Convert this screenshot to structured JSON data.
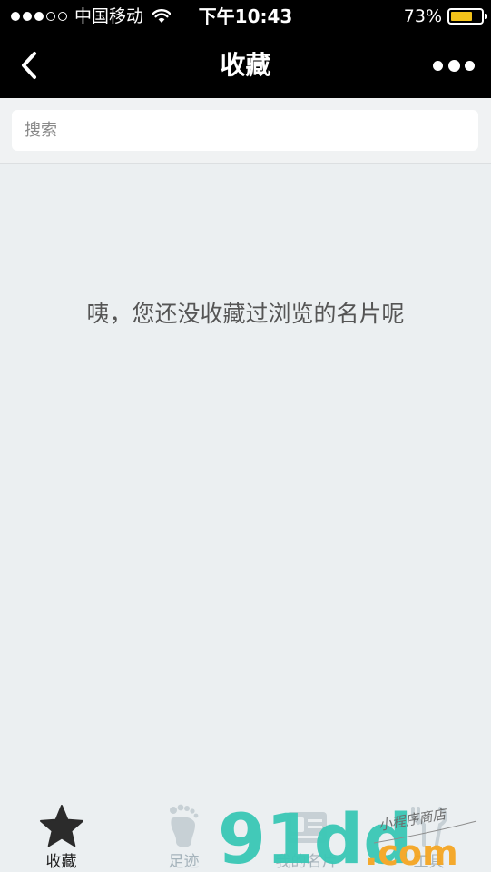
{
  "status_bar": {
    "signal_full": 3,
    "signal_empty": 2,
    "carrier": "中国移动",
    "time": "下午10:43",
    "battery_percent": "73%",
    "battery_level": 0.73,
    "battery_color": "#f3c21a"
  },
  "nav": {
    "title": "收藏",
    "back_icon": "chevron-left-icon",
    "more_icon": "more-dots-icon"
  },
  "search": {
    "placeholder": "搜索",
    "value": ""
  },
  "empty_state": {
    "message": "咦，您还没收藏过浏览的名片呢"
  },
  "tabs": [
    {
      "label": "收藏",
      "icon": "star-icon",
      "active": true
    },
    {
      "label": "足迹",
      "icon": "footprint-icon",
      "active": false
    },
    {
      "label": "我的名片",
      "icon": "card-icon",
      "active": false
    },
    {
      "label": "工具",
      "icon": "tools-icon",
      "active": false
    }
  ],
  "watermark": {
    "brand_text": "91dd",
    "brand_suffix": ".com",
    "tagline": "小程序商店",
    "brand_color": "#3ac8b6",
    "suffix_color": "#f5a623"
  },
  "colors": {
    "header_bg": "#000000",
    "page_bg": "#ebeff1",
    "active_tab": "#222222",
    "inactive_tab": "#a5b3bb"
  }
}
